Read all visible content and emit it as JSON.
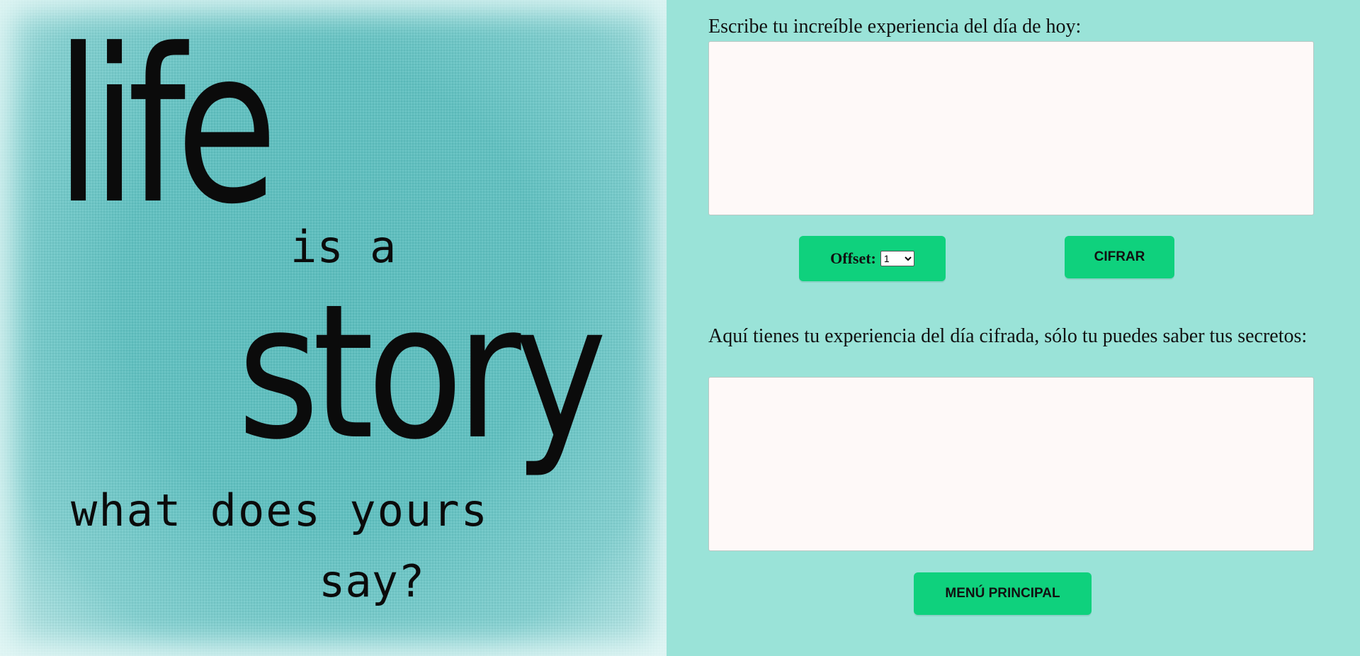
{
  "poster": {
    "line_life": "life",
    "line_is_a": "is a",
    "line_story": "story",
    "line_what_does_yours": "what does yours",
    "line_say": "say?"
  },
  "form": {
    "input_label": "Escribe tu increíble experiencia del día de hoy:",
    "input_value": "",
    "offset_label": "Offset:",
    "offset_selected": "1",
    "encrypt_button": "CIFRAR",
    "output_label": "Aquí tienes tu experiencia del día cifrada, sólo tu puedes saber tus secretos:",
    "output_value": "",
    "menu_button": "MENÚ PRINCIPAL"
  },
  "colors": {
    "background": "#9ae3d8",
    "button": "#0fd17d",
    "textarea": "#fef9f8"
  }
}
